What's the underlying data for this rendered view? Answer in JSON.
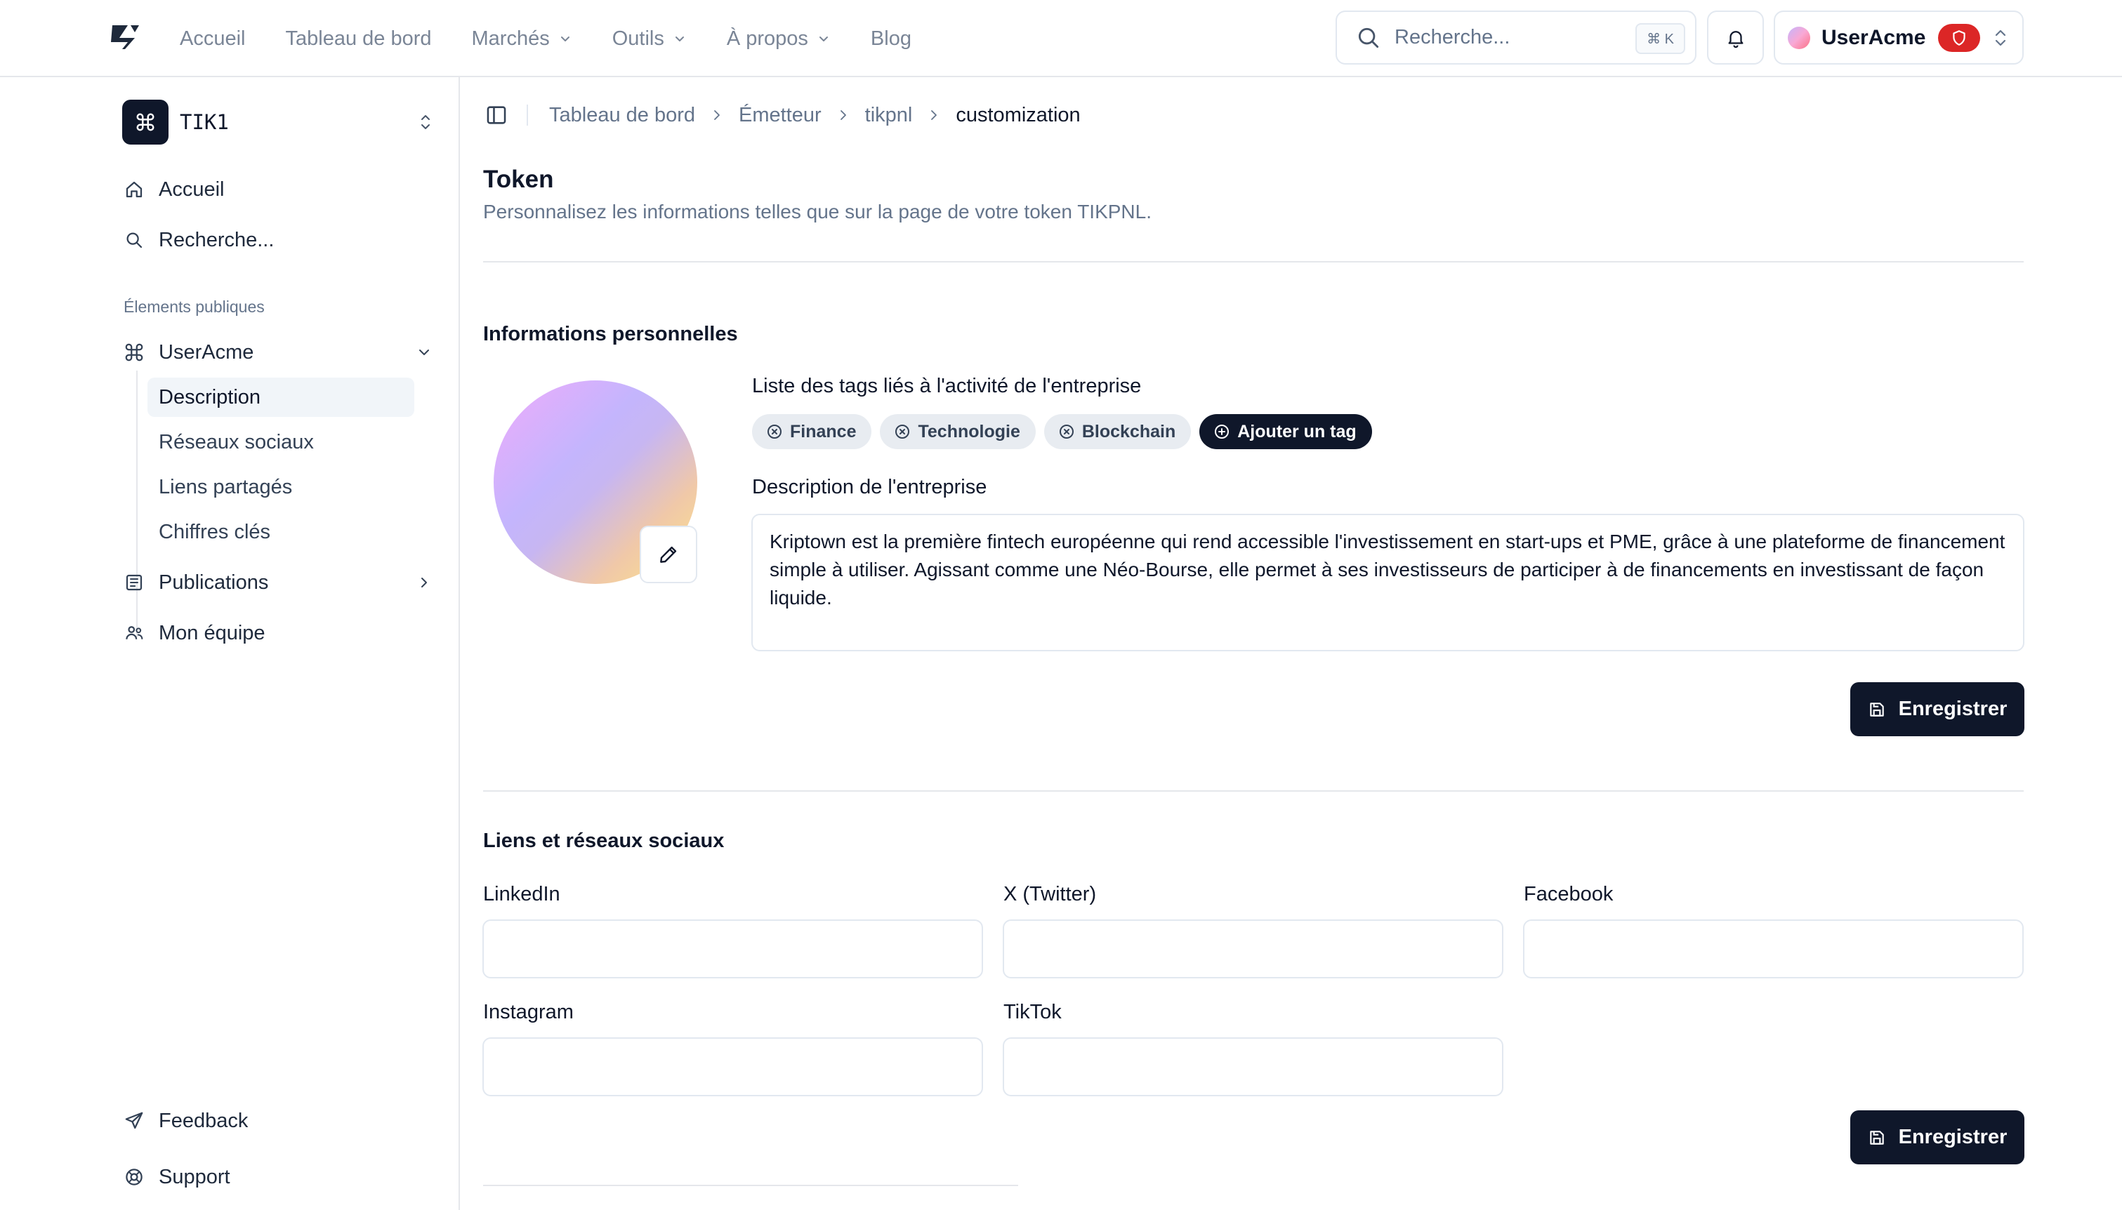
{
  "topnav": {
    "items": [
      {
        "label": "Accueil",
        "dropdown": false
      },
      {
        "label": "Tableau de bord",
        "dropdown": false
      },
      {
        "label": "Marchés",
        "dropdown": true
      },
      {
        "label": "Outils",
        "dropdown": true
      },
      {
        "label": "À propos",
        "dropdown": true
      },
      {
        "label": "Blog",
        "dropdown": false
      }
    ],
    "search_placeholder": "Recherche...",
    "search_shortcut": "⌘ K",
    "user_name": "UserAcme"
  },
  "sidebar": {
    "org_name": "TIK1",
    "home": "Accueil",
    "search": "Recherche...",
    "group_label": "Élements publiques",
    "user_group": "UserAcme",
    "sub_items": [
      "Description",
      "Réseaux sociaux",
      "Liens partagés",
      "Chiffres clés"
    ],
    "active_sub": "Description",
    "publications": "Publications",
    "team": "Mon équipe",
    "feedback": "Feedback",
    "support": "Support"
  },
  "breadcrumb": [
    "Tableau de bord",
    "Émetteur",
    "tikpnl",
    "customization"
  ],
  "page": {
    "title": "Token",
    "subtitle": "Personnalisez les informations telles que sur la page de votre token TIKPNL."
  },
  "personal": {
    "section_title": "Informations personnelles",
    "tags_label": "Liste des tags liés à l'activité de l'entreprise",
    "tags": [
      "Finance",
      "Technologie",
      "Blockchain"
    ],
    "add_tag": "Ajouter un tag",
    "description_label": "Description de l'entreprise",
    "description": "Kriptown est la première fintech européenne qui rend accessible l'investissement en start-ups et PME, grâce à une plateforme de financement simple à utiliser. Agissant comme une Néo-Bourse, elle permet à ses investisseurs de participer à de financements en investissant de façon liquide.",
    "save": "Enregistrer"
  },
  "social": {
    "section_title": "Liens et réseaux sociaux",
    "linkedin": {
      "label": "LinkedIn",
      "value": ""
    },
    "twitter": {
      "label": "X (Twitter)",
      "value": ""
    },
    "facebook": {
      "label": "Facebook",
      "value": ""
    },
    "instagram": {
      "label": "Instagram",
      "value": ""
    },
    "tiktok": {
      "label": "TikTok",
      "value": ""
    },
    "save": "Enregistrer"
  },
  "colors": {
    "primary": "#0f172a",
    "muted": "#64748b",
    "border": "#e2e8f0",
    "danger": "#dc2626",
    "tag_bg": "#e8ecf1"
  }
}
